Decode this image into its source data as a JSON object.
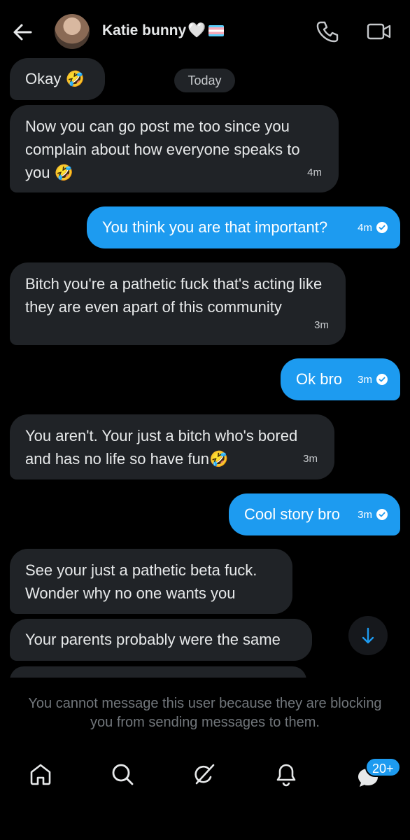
{
  "header": {
    "contact_name": "Katie bunny",
    "heart": "🤍",
    "icons": {
      "back": "back-arrow-icon",
      "call": "phone-icon",
      "video": "video-call-icon",
      "flag": "transgender-flag-icon"
    }
  },
  "date_separator": "Today",
  "messages": [
    {
      "side": "in",
      "text": "Okay 🤣",
      "time": ""
    },
    {
      "side": "in",
      "text": "Now you can go post me too since you complain about how everyone speaks to you 🤣",
      "time": "4m"
    },
    {
      "side": "out",
      "text": "You think you are that important?",
      "time": "4m"
    },
    {
      "side": "in",
      "text": "Bitch you're a pathetic fuck that's acting like they are even apart of this community",
      "time": "3m"
    },
    {
      "side": "out",
      "text": "Ok bro",
      "time": "3m"
    },
    {
      "side": "in",
      "text": "You aren't. Your just a bitch who's bored and has no life  so have fun🤣",
      "time": "3m"
    },
    {
      "side": "out",
      "text": "Cool story bro",
      "time": "3m"
    },
    {
      "side": "in",
      "text": "See your just a pathetic beta fuck. Wonder why no one wants you",
      "time": ""
    },
    {
      "side": "in",
      "text": "Your parents probably were the same",
      "time": ""
    }
  ],
  "blocked_notice": "You cannot message this user because they are blocking you from sending messages to them.",
  "bottom_nav": {
    "items": [
      "home-icon",
      "search-icon",
      "grok-icon",
      "notifications-icon",
      "messages-icon"
    ],
    "messages_badge": "20+"
  },
  "colors": {
    "accent": "#1d9bf0",
    "incoming_bubble": "#202327",
    "background": "#000000",
    "muted_text": "#71767b"
  }
}
